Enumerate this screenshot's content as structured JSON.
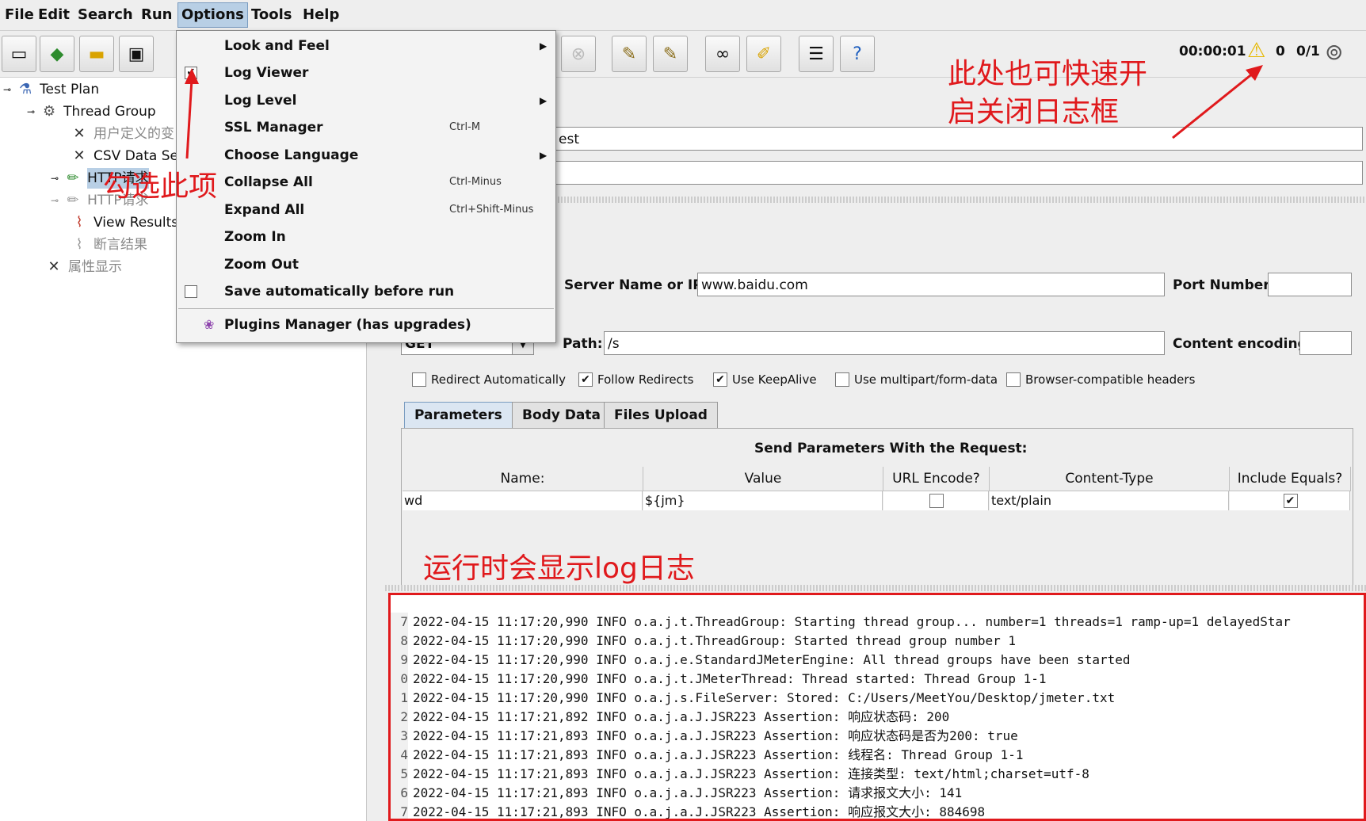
{
  "menubar": {
    "items": [
      "File",
      "Edit",
      "Search",
      "Run",
      "Options",
      "Tools",
      "Help"
    ]
  },
  "toolbar": {
    "timer": "00:00:01",
    "warning_count": "0",
    "threads": "0/1"
  },
  "options_menu": {
    "items": [
      {
        "label": "Look and Feel",
        "shortcut": "",
        "submenu": true,
        "checkbox": null
      },
      {
        "label": "Log Viewer",
        "shortcut": "",
        "submenu": false,
        "checkbox": true
      },
      {
        "label": "Log Level",
        "shortcut": "",
        "submenu": true,
        "checkbox": null
      },
      {
        "label": "SSL Manager",
        "shortcut": "Ctrl-M",
        "submenu": false,
        "checkbox": null
      },
      {
        "label": "Choose Language",
        "shortcut": "",
        "submenu": true,
        "checkbox": null
      },
      {
        "label": "Collapse All",
        "shortcut": "Ctrl-Minus",
        "submenu": false,
        "checkbox": null
      },
      {
        "label": "Expand All",
        "shortcut": "Ctrl+Shift-Minus",
        "submenu": false,
        "checkbox": null
      },
      {
        "label": "Zoom In",
        "shortcut": "",
        "submenu": false,
        "checkbox": null
      },
      {
        "label": "Zoom Out",
        "shortcut": "",
        "submenu": false,
        "checkbox": null
      },
      {
        "label": "Save automatically before run",
        "shortcut": "",
        "submenu": false,
        "checkbox": false
      },
      {
        "label": "Plugins Manager (has upgrades)",
        "shortcut": "",
        "submenu": false,
        "checkbox": null
      }
    ]
  },
  "tree": {
    "nodes": [
      {
        "label": "Test Plan",
        "icon": "flask-icon",
        "disabled": false
      },
      {
        "label": "Thread Group",
        "icon": "gear-icon",
        "disabled": false
      },
      {
        "label": "用户定义的变",
        "icon": "wrench-icon",
        "disabled": true
      },
      {
        "label": "CSV Data Se",
        "icon": "wrench-icon",
        "disabled": false
      },
      {
        "label": "HTTP请求",
        "icon": "pipette-icon",
        "disabled": false
      },
      {
        "label": "HTTP请求",
        "icon": "pipette-icon",
        "disabled": true
      },
      {
        "label": "View Results",
        "icon": "chart-icon",
        "disabled": false
      },
      {
        "label": "断言结果",
        "icon": "chart-icon",
        "disabled": true
      },
      {
        "label": "属性显示",
        "icon": "wrench-icon",
        "disabled": true
      }
    ]
  },
  "sampler": {
    "name_value": "est",
    "server_label": "Server Name or IP:",
    "server_value": "www.baidu.com",
    "port_label": "Port Number:",
    "port_value": "",
    "method_value": "GET",
    "path_label": "Path:",
    "path_value": "/s",
    "encoding_label": "Content encoding:",
    "encoding_value": "",
    "checkboxes": [
      {
        "label": "Redirect Automatically",
        "checked": false
      },
      {
        "label": "Follow Redirects",
        "checked": true
      },
      {
        "label": "Use KeepAlive",
        "checked": true
      },
      {
        "label": "Use multipart/form-data",
        "checked": false
      },
      {
        "label": "Browser-compatible headers",
        "checked": false
      }
    ],
    "tabs": [
      "Parameters",
      "Body Data",
      "Files Upload"
    ],
    "params_title": "Send Parameters With the Request:",
    "columns": [
      "Name:",
      "Value",
      "URL Encode?",
      "Content-Type",
      "Include Equals?"
    ],
    "rows": [
      {
        "name": "wd",
        "value": "${jm}",
        "url_encode": false,
        "content_type": "text/plain",
        "include_equals": true
      }
    ]
  },
  "log": {
    "lines": [
      {
        "n": "7",
        "text": "2022-04-15 11:17:20,990 INFO o.a.j.t.ThreadGroup: Starting thread group... number=1 threads=1 ramp-up=1 delayedStar"
      },
      {
        "n": "8",
        "text": "2022-04-15 11:17:20,990 INFO o.a.j.t.ThreadGroup: Started thread group number 1"
      },
      {
        "n": "9",
        "text": "2022-04-15 11:17:20,990 INFO o.a.j.e.StandardJMeterEngine: All thread groups have been started"
      },
      {
        "n": "0",
        "text": "2022-04-15 11:17:20,990 INFO o.a.j.t.JMeterThread: Thread started: Thread Group 1-1"
      },
      {
        "n": "1",
        "text": "2022-04-15 11:17:20,990 INFO o.a.j.s.FileServer: Stored: C:/Users/MeetYou/Desktop/jmeter.txt"
      },
      {
        "n": "2",
        "text": "2022-04-15 11:17:21,892 INFO o.a.j.a.J.JSR223 Assertion: 响应状态码: 200"
      },
      {
        "n": "3",
        "text": "2022-04-15 11:17:21,893 INFO o.a.j.a.J.JSR223 Assertion: 响应状态码是否为200:  true"
      },
      {
        "n": "4",
        "text": "2022-04-15 11:17:21,893 INFO o.a.j.a.J.JSR223 Assertion: 线程名:  Thread Group 1-1"
      },
      {
        "n": "5",
        "text": "2022-04-15 11:17:21,893 INFO o.a.j.a.J.JSR223 Assertion: 连接类型: text/html;charset=utf-8"
      },
      {
        "n": "6",
        "text": "2022-04-15 11:17:21,893 INFO o.a.j.a.J.JSR223 Assertion: 请求报文大小:  141"
      },
      {
        "n": "7",
        "text": "2022-04-15 11:17:21,893 INFO o.a.j.a.J.JSR223 Assertion: 响应报文大小: 884698"
      }
    ]
  },
  "annotations": {
    "check_this": "勾选此项",
    "toggle_hint_line1": "此处也可快速开",
    "toggle_hint_line2": "启关闭日志框",
    "runtime_hint": "运行时会显示log日志"
  },
  "colors": {
    "annotation_red": "#e0191c",
    "menu_highlight": "#b8cfe5"
  }
}
